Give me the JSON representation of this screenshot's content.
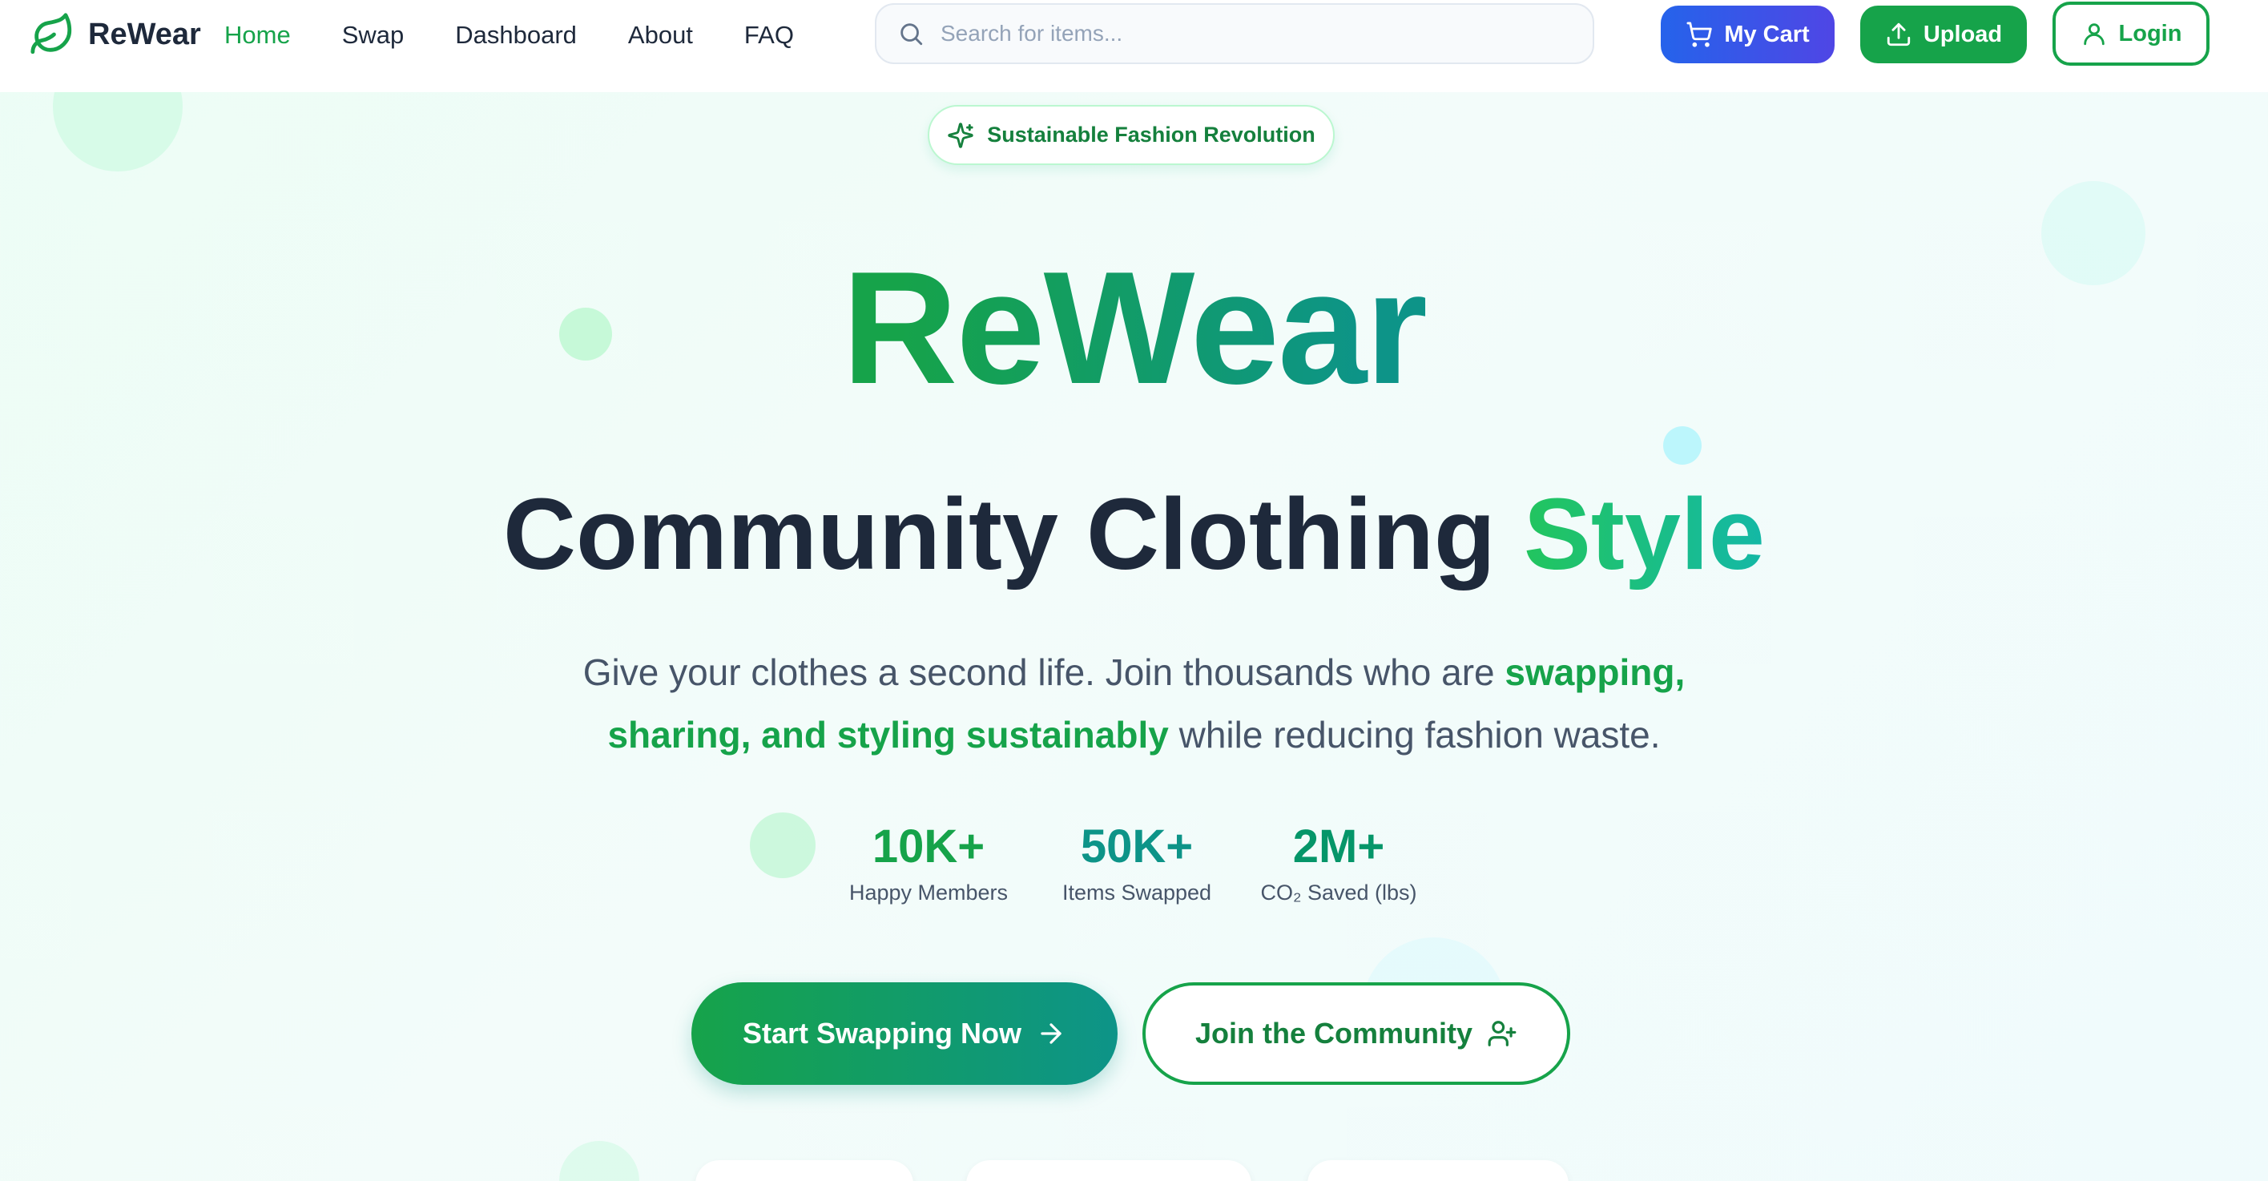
{
  "brand": {
    "name": "ReWear"
  },
  "nav": {
    "links": [
      "Home",
      "Swap",
      "Dashboard",
      "About",
      "FAQ"
    ],
    "active": "Home"
  },
  "search": {
    "placeholder": "Search for items..."
  },
  "actions": {
    "cart_label": "My Cart",
    "upload_label": "Upload",
    "login_label": "Login"
  },
  "hero": {
    "badge": "Sustainable Fashion Revolution",
    "title": "ReWear",
    "subtitle_main": "Community Clothing ",
    "subtitle_accent": "Style",
    "description_1": "Give your clothes a second life. Join thousands who are ",
    "description_highlight": "swapping, sharing, and styling sustainably",
    "description_2": " while reducing fashion waste."
  },
  "stats": [
    {
      "value": "10K+",
      "label": "Happy Members"
    },
    {
      "value": "50K+",
      "label": "Items Swapped"
    },
    {
      "value": "2M+",
      "label": "CO₂ Saved (lbs)"
    }
  ],
  "cta": {
    "primary": "Start Swapping Now",
    "secondary": "Join the Community"
  },
  "colors": {
    "primary": "#16a34a",
    "teal": "#0d9488",
    "cart": "#2563eb",
    "text": "#1e293b"
  }
}
